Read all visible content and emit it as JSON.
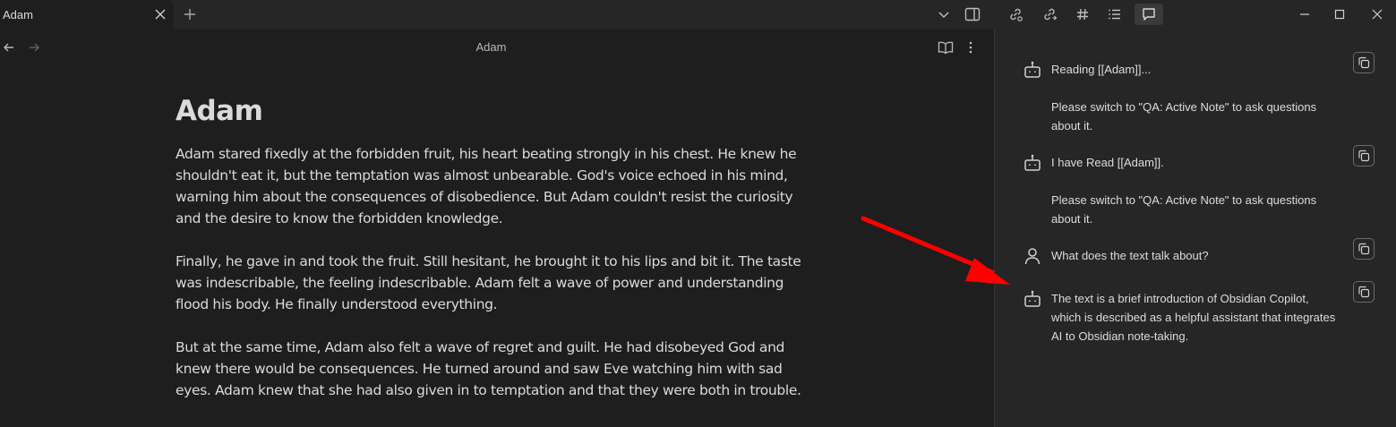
{
  "tab": {
    "title": "Adam"
  },
  "view": {
    "title": "Adam"
  },
  "note": {
    "title": "Adam",
    "paragraphs": [
      "Adam stared fixedly at the forbidden fruit, his heart beating strongly in his chest. He knew he shouldn't eat it, but the temptation was almost unbearable. God's voice echoed in his mind, warning him about the consequences of disobedience. But Adam couldn't resist the curiosity and the desire to know the forbidden knowledge.",
      "Finally, he gave in and took the fruit. Still hesitant, he brought it to his lips and bit it. The taste was indescribable, the feeling indescribable. Adam felt a wave of power and understanding flood his body. He finally understood everything.",
      "But at the same time, Adam also felt a wave of regret and guilt. He had disobeyed God and knew there would be consequences. He turned around and saw Eve watching him with sad eyes. Adam knew that she had also given in to temptation and that they were both in trouble."
    ]
  },
  "chat": {
    "messages": [
      {
        "role": "bot",
        "text": "Reading [[Adam]]...",
        "note": "Please switch to \"QA: Active Note\" to ask questions about it."
      },
      {
        "role": "bot",
        "text": "I have Read [[Adam]].",
        "note": "Please switch to \"QA: Active Note\" to ask questions about it."
      },
      {
        "role": "user",
        "text": "What does the text talk about?"
      },
      {
        "role": "bot",
        "text": "The text is a brief introduction of Obsidian Copilot, which is described as a helpful assistant that integrates AI to Obsidian note-taking."
      }
    ]
  },
  "colors": {
    "annotation_arrow": "#ff0000",
    "spell_underline": "#c42b2b"
  },
  "icons": [
    "close-icon",
    "plus-icon",
    "chevron-down-icon",
    "sidebar-toggle-icon",
    "link-icon",
    "unlink-icon",
    "hash-icon",
    "list-icon",
    "chat-icon",
    "minimize-icon",
    "maximize-icon",
    "window-close-icon",
    "arrow-left-icon",
    "arrow-right-icon",
    "book-open-icon",
    "more-vertical-icon",
    "bot-icon",
    "user-icon",
    "copy-icon"
  ]
}
